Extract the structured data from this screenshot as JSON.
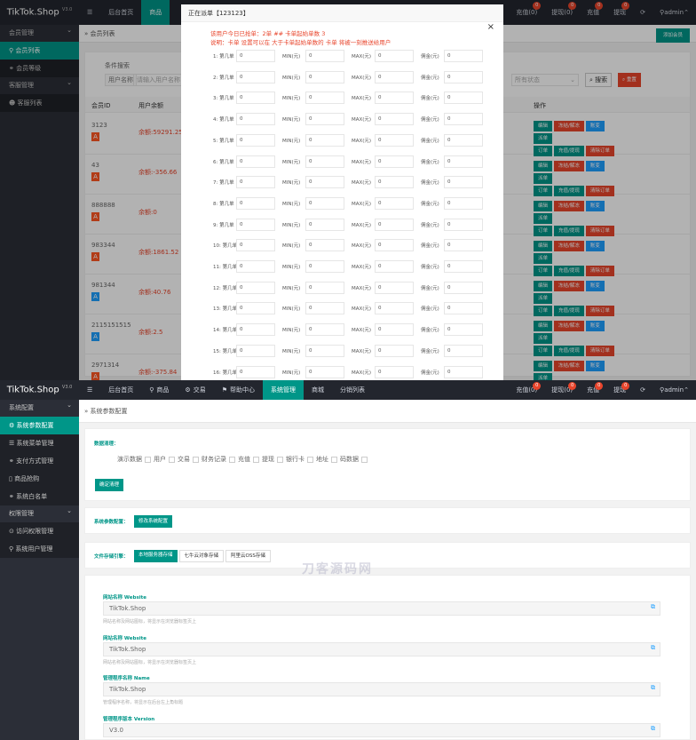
{
  "brand": {
    "name": "TikTok.Shop",
    "ver": "V3.0"
  },
  "top": {
    "nav": [
      "后台首页",
      "商品"
    ],
    "rnav": [
      {
        "label": "充值(0)",
        "badge": "0"
      },
      {
        "label": "提现(0)",
        "badge": "0"
      },
      {
        "label": "充值",
        "badge": "0"
      },
      {
        "label": "提现",
        "badge": "0"
      }
    ],
    "admin": "admin",
    "side": [
      {
        "type": "g",
        "label": "会员管理"
      },
      {
        "type": "s",
        "label": "会员列表",
        "on": true,
        "icon": "user-icon"
      },
      {
        "type": "s",
        "label": "会员等级",
        "icon": "link-icon"
      },
      {
        "type": "g",
        "label": "客服管理"
      },
      {
        "type": "s",
        "label": "客服列表",
        "icon": "users-icon"
      }
    ],
    "crumb": "会员列表",
    "add_btn": "添加会员",
    "search_title": "条件搜索",
    "search_user_label": "用户名称",
    "search_user_ph": "请输入用户名称",
    "search_status_ph": "所有状态",
    "search_btn": "搜索",
    "reset_btn": "重置",
    "col_id": "会员ID",
    "col_user": "用户余额",
    "col_op": "操作",
    "rows": [
      {
        "id": "3123",
        "amt": "余额:59291.25",
        "tag": "A",
        "tagc": "r"
      },
      {
        "id": "43",
        "amt": "余额:-356.66",
        "tag": "A",
        "tagc": "r"
      },
      {
        "id": "888888",
        "amt": "余额:0",
        "tag": "A",
        "tagc": "r"
      },
      {
        "id": "983344",
        "amt": "余额:1861.52",
        "tag": "A",
        "tagc": "r"
      },
      {
        "id": "981344",
        "amt": "余额:40.76",
        "tag": "A",
        "tagc": "b"
      },
      {
        "id": "2115151515",
        "amt": "余额:2.5",
        "tag": "A",
        "tagc": "b"
      },
      {
        "id": "2971314",
        "amt": "余额:-375.84",
        "tag": "A",
        "tagc": "r"
      }
    ],
    "ops1": [
      {
        "l": "编辑",
        "c": "g1"
      },
      {
        "l": "冻结/解冻",
        "c": "r1"
      },
      {
        "l": "账变",
        "c": "b1"
      },
      {
        "l": "派单",
        "c": "g1"
      }
    ],
    "ops2": [
      {
        "l": "订单",
        "c": "g1"
      },
      {
        "l": "充值/提现",
        "c": "g1"
      },
      {
        "l": "清除订单",
        "c": "r1"
      }
    ]
  },
  "modal": {
    "title": "正在派单【123123】",
    "close": "×",
    "note1": "该用户今日已抢单：2单 ## 卡单起始单数 3",
    "note2": "说明：卡单 设置可以在 大于卡单起始单数的 卡单 将被一刻推送给用户",
    "lab_n": "第几单",
    "lab_min": "MIN(元)",
    "lab_max": "MAX(元)",
    "lab_y": "佣金(元)",
    "rows": [
      "1",
      "2",
      "3",
      "4",
      "5",
      "6",
      "7",
      "8",
      "9",
      "10",
      "11",
      "12",
      "13",
      "14",
      "15",
      "16"
    ],
    "val": "0"
  },
  "bottom": {
    "nav": [
      {
        "l": "后台首页",
        "icon": ""
      },
      {
        "l": "商品",
        "icon": "user-icon"
      },
      {
        "l": "交易",
        "icon": "cog-icon"
      },
      {
        "l": "帮助中心",
        "icon": "flag-icon"
      },
      {
        "l": "系统管理",
        "icon": "",
        "on": true
      },
      {
        "l": "商城",
        "icon": ""
      },
      {
        "l": "分销列表",
        "icon": ""
      }
    ],
    "side": [
      {
        "type": "g",
        "label": "系统配置"
      },
      {
        "type": "s",
        "label": "系统参数配置",
        "on": true,
        "icon": "gear-icon"
      },
      {
        "type": "s",
        "label": "系统菜单管理",
        "icon": "menu-icon"
      },
      {
        "type": "s",
        "label": "支付方式管理",
        "icon": "link-icon"
      },
      {
        "type": "s",
        "label": "商品抢购",
        "icon": "doc-icon"
      },
      {
        "type": "s",
        "label": "系统白名单",
        "icon": "link-icon"
      },
      {
        "type": "g",
        "label": "权限管理"
      },
      {
        "type": "s",
        "label": "访问权限管理",
        "icon": "check-icon"
      },
      {
        "type": "s",
        "label": "系统用户管理",
        "icon": "user-icon"
      }
    ],
    "crumb": "系统参数配置",
    "perm_label": "数据清理：",
    "checks": [
      "演示数据",
      "用户",
      "交易",
      "财务记录",
      "充值",
      "提现",
      "银行卡",
      "地址",
      "码数据"
    ],
    "clean_btn": "确定清理",
    "sys_label": "系统参数配置：",
    "sys_btn": "修改系统配置",
    "store_label": "文件存储引擎：",
    "store_tabs": [
      {
        "l": "本地服务器存储",
        "on": true
      },
      {
        "l": "七牛云对象存储"
      },
      {
        "l": "阿里云OSS存储"
      }
    ],
    "fields": [
      {
        "label": "网站名称 Website",
        "value": "TikTok.Shop",
        "help": "网站名称及网站图标，将显示在浏览器标签页上"
      },
      {
        "label": "网站名称 Website",
        "value": "TikTok.Shop",
        "help": "网站名称及网站图标，将显示在浏览器标签页上"
      },
      {
        "label": "管理程序名称 Name",
        "value": "TikTok.Shop",
        "help": "管理程序名称，将显示在后台左上角标题"
      },
      {
        "label": "管理程序版本 Version",
        "value": "V3.0",
        "help": "管理程序版本，将显示在后台左上角标题"
      }
    ],
    "watermark": "刀客源码网"
  }
}
